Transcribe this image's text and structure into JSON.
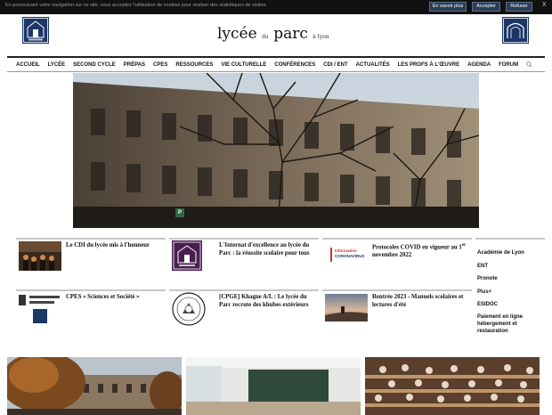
{
  "cookie_bar": {
    "text": "En poursuivant votre navigation sur ce site, vous acceptez l'utilisation de cookies pour réaliser des statistiques de visites.",
    "more_label": "En savoir plus",
    "accept_label": "Accepter",
    "refuse_label": "Refuser",
    "close_label": "X"
  },
  "header": {
    "title_part1": "lycée",
    "title_part2": "du",
    "title_part3": "parc",
    "title_part4": "à lyon"
  },
  "nav": {
    "items": [
      "ACCUEIL",
      "LYCÉE",
      "SECOND CYCLE",
      "PRÉPAS",
      "CPES",
      "RESSOURCES",
      "VIE CULTURELLE",
      "CONFÉRENCES",
      "CDI / ENT",
      "ACTUALITÉS",
      "LES PROFS À L'ŒUVRE",
      "AGENDA",
      "FORUM"
    ]
  },
  "hero": {
    "badge": "P"
  },
  "news": [
    {
      "title": "Le CDI du lycée mis à l'honneur"
    },
    {
      "title": "L'Internat d'excellence au lycée du Parc : la réussite scolaire pour tous"
    },
    {
      "title": "Protocoles COVID en vigueur au 1",
      "title_sup": "er",
      "title_rest": " novembre 2022",
      "thumb_line1": "Information",
      "thumb_line2": "CORONAVIRUS"
    },
    {
      "title": "CPES « Sciences et Société »"
    },
    {
      "title": "[CPGE] Khagne A/L : Le lycée du Parc recrute des khubes extérieurs"
    },
    {
      "title": "Rentrée 2023 - Manuels scolaires et lectures d'été"
    }
  ],
  "sidebar": {
    "links": [
      "Académie de Lyon",
      "ENT",
      "Pronote",
      "Plus+",
      "ESIDOC",
      "Paiement en ligne hébergement et restauration"
    ]
  },
  "colors": {
    "navy": "#1c3766",
    "cookie_bg": "#111111",
    "rule": "#c8c8c8"
  }
}
